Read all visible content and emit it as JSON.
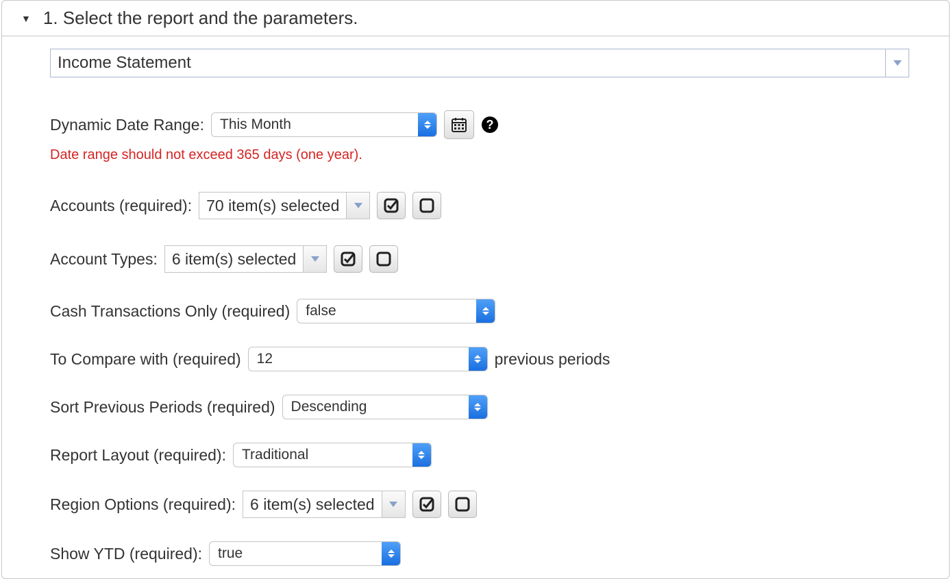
{
  "panel": {
    "title": "1. Select the report and the parameters."
  },
  "report_select": {
    "value": "Income Statement"
  },
  "dynamic_date_range": {
    "label": "Dynamic Date Range:",
    "value": "This Month"
  },
  "date_range_warning": "Date range should not exceed 365 days (one year).",
  "accounts": {
    "label": "Accounts (required):",
    "value": "70 item(s) selected"
  },
  "account_types": {
    "label": "Account Types:",
    "value": "6 item(s) selected"
  },
  "cash_transactions_only": {
    "label": "Cash Transactions Only (required)",
    "value": "false"
  },
  "to_compare_with": {
    "label": "To Compare with (required)",
    "value": "12",
    "suffix": "previous periods"
  },
  "sort_previous_periods": {
    "label": "Sort Previous Periods (required)",
    "value": "Descending"
  },
  "report_layout": {
    "label": "Report Layout (required):",
    "value": "Traditional"
  },
  "region_options": {
    "label": "Region Options (required):",
    "value": "6 item(s) selected"
  },
  "show_ytd": {
    "label": "Show YTD (required):",
    "value": "true"
  }
}
